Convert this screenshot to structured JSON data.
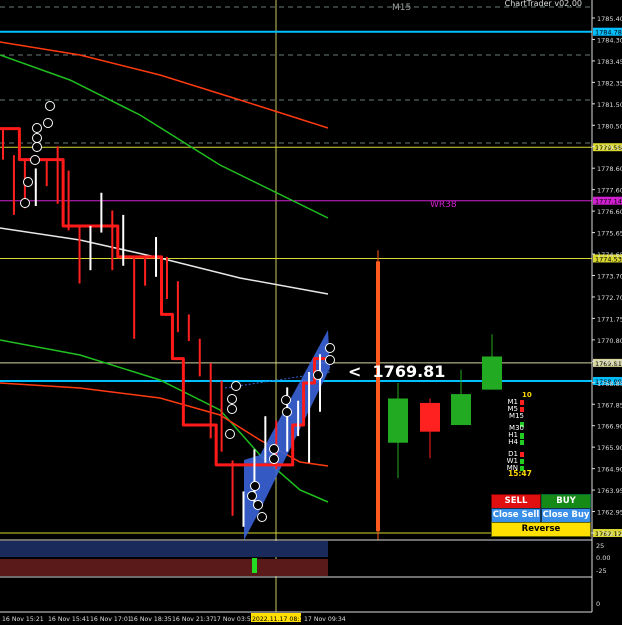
{
  "window": {
    "title": "ChartTrader v02.00",
    "timeframe": "M15"
  },
  "price_display": {
    "arrow": "<",
    "value": "1769.81"
  },
  "trade_buttons": {
    "sell": "SELL",
    "buy": "BUY",
    "close_sell": "Close Sell",
    "close_buy": "Close Buy",
    "reverse": "Reverse"
  },
  "timeframe_panel": {
    "count": "10",
    "items": [
      {
        "label": "M1",
        "color": "#ff2020"
      },
      {
        "label": "M5",
        "color": "#ff2020"
      },
      {
        "label": "M15",
        "color": "#22cc22"
      },
      {
        "label": "M30",
        "color": "#22cc22"
      },
      {
        "label": "H1",
        "color": "#22cc22"
      },
      {
        "label": "H4",
        "color": "#22cc22"
      },
      {
        "label": "D1",
        "color": "#ff2020"
      },
      {
        "label": "W1",
        "color": "#22cc22"
      },
      {
        "label": "MN",
        "color": "#22cc22"
      }
    ],
    "countdown": "15:47"
  },
  "level_labels": {
    "wr38": "WR38"
  },
  "chart_data": {
    "type": "candlestick",
    "symbol_timeframe": "M15",
    "price_axis": {
      "range": [
        1761.9,
        1785.9
      ],
      "ticks": [
        "1785.40",
        "1784.30",
        "1783.45",
        "1782.35",
        "1781.50",
        "1780.50",
        "1779.55",
        "1778.60",
        "1777.60",
        "1776.60",
        "1775.65",
        "1774.65",
        "1773.70",
        "1772.70",
        "1771.75",
        "1770.80",
        "1769.81",
        "1768.85",
        "1767.85",
        "1766.90",
        "1765.90",
        "1764.90",
        "1763.95",
        "1762.95",
        "1762.12"
      ]
    },
    "time_axis": {
      "labels": [
        "16 Nov 15:21",
        "16 Nov 15:41",
        "16 Nov 17:01",
        "16 Nov 18:35",
        "16 Nov 21:37",
        "17 Nov 03:52",
        "2022.11.17 08:17",
        "17 Nov 09:34"
      ]
    },
    "horizontal_lines": [
      {
        "price": 1784.78,
        "label": "1784.78",
        "color": "#00bfff"
      },
      {
        "price": 1779.56,
        "label": "1779.56",
        "color": "#d8d830"
      },
      {
        "price": 1777.14,
        "label": "1777.14",
        "color": "#d020d0"
      },
      {
        "price": 1774.53,
        "label": "1774.53",
        "color": "#d8d830"
      },
      {
        "price": 1769.81,
        "label": "1769.81",
        "color": "#d8d8a0"
      },
      {
        "price": 1768.99,
        "label": "1768.99",
        "color": "#00bfff"
      },
      {
        "price": 1762.12,
        "label": "1762.12",
        "color": "#d8d830"
      }
    ],
    "candles": [
      {
        "o": 1780.4,
        "h": 1780.4,
        "l": 1779.0,
        "c": 1779.0,
        "bull": false
      },
      {
        "o": 1779.0,
        "h": 1779.2,
        "l": 1776.5,
        "c": 1778.8,
        "bull": false
      },
      {
        "o": 1778.5,
        "h": 1779.0,
        "l": 1776.8,
        "c": 1777.2,
        "bull": false
      },
      {
        "o": 1777.2,
        "h": 1778.6,
        "l": 1776.9,
        "c": 1778.2,
        "bull": true
      },
      {
        "o": 1778.5,
        "h": 1779.0,
        "l": 1777.8,
        "c": 1778.8,
        "bull": false
      },
      {
        "o": 1779.0,
        "h": 1779.6,
        "l": 1777.0,
        "c": 1777.5,
        "bull": false
      },
      {
        "o": 1777.5,
        "h": 1778.5,
        "l": 1775.8,
        "c": 1776.0,
        "bull": false
      },
      {
        "o": 1775.8,
        "h": 1776.0,
        "l": 1773.4,
        "c": 1774.2,
        "bull": false
      },
      {
        "o": 1774.0,
        "h": 1776.0,
        "l": 1774.0,
        "c": 1775.5,
        "bull": true
      },
      {
        "o": 1776.5,
        "h": 1777.5,
        "l": 1775.7,
        "c": 1777.1,
        "bull": true
      },
      {
        "o": 1776.2,
        "h": 1776.7,
        "l": 1774.0,
        "c": 1774.4,
        "bull": false
      },
      {
        "o": 1774.5,
        "h": 1776.5,
        "l": 1774.2,
        "c": 1776.0,
        "bull": true
      },
      {
        "o": 1774.3,
        "h": 1774.6,
        "l": 1770.9,
        "c": 1771.5,
        "bull": false
      },
      {
        "o": 1774.6,
        "h": 1774.6,
        "l": 1773.3,
        "c": 1773.8,
        "bull": false
      },
      {
        "o": 1774.0,
        "h": 1775.5,
        "l": 1773.7,
        "c": 1775.3,
        "bull": true
      },
      {
        "o": 1774.4,
        "h": 1774.6,
        "l": 1772.7,
        "c": 1773.5,
        "bull": false
      },
      {
        "o": 1773.0,
        "h": 1773.5,
        "l": 1771.2,
        "c": 1771.6,
        "bull": false
      },
      {
        "o": 1771.7,
        "h": 1772.0,
        "l": 1770.8,
        "c": 1771.0,
        "bull": false
      },
      {
        "o": 1770.4,
        "h": 1770.9,
        "l": 1769.2,
        "c": 1769.6,
        "bull": false
      },
      {
        "o": 1769.4,
        "h": 1769.8,
        "l": 1766.4,
        "c": 1766.9,
        "bull": false
      },
      {
        "o": 1767.5,
        "h": 1769.0,
        "l": 1765.8,
        "c": 1766.2,
        "bull": false
      },
      {
        "o": 1765.2,
        "h": 1765.4,
        "l": 1762.9,
        "c": 1763.3,
        "bull": false
      },
      {
        "o": 1763.2,
        "h": 1764.0,
        "l": 1762.4,
        "c": 1763.7,
        "bull": true
      },
      {
        "o": 1763.7,
        "h": 1765.9,
        "l": 1763.3,
        "c": 1765.6,
        "bull": true
      },
      {
        "o": 1765.8,
        "h": 1767.4,
        "l": 1765.3,
        "c": 1767.0,
        "bull": true
      },
      {
        "o": 1766.8,
        "h": 1767.2,
        "l": 1765.0,
        "c": 1765.6,
        "bull": false
      },
      {
        "o": 1765.8,
        "h": 1768.7,
        "l": 1765.8,
        "c": 1767.7,
        "bull": true
      },
      {
        "o": 1767.0,
        "h": 1768.1,
        "l": 1766.5,
        "c": 1767.8,
        "bull": true
      },
      {
        "o": 1767.0,
        "h": 1769.4,
        "l": 1765.3,
        "c": 1769.1,
        "bull": true
      },
      {
        "o": 1768.3,
        "h": 1770.2,
        "l": 1767.6,
        "c": 1769.9,
        "bull": true
      }
    ],
    "step_line": [
      1780.4,
      1780.4,
      1779.0,
      1779.0,
      1779.0,
      1779.0,
      1776.0,
      1776.0,
      1776.0,
      1776.0,
      1776.0,
      1774.6,
      1774.6,
      1774.6,
      1774.6,
      1772.0,
      1770.0,
      1767.0,
      1767.0,
      1767.0,
      1765.2,
      1765.2,
      1765.2,
      1765.2,
      1765.2,
      1765.2,
      1765.2,
      1767.0,
      1768.9,
      1770.0
    ],
    "htf_candles": [
      {
        "o": 1762.2,
        "h": 1774.9,
        "l": 1762.2,
        "c": 1774.4,
        "color": "#ff5a1f"
      },
      {
        "o": 1768.2,
        "h": 1768.9,
        "l": 1764.6,
        "c": 1766.2,
        "color": "#22aa22"
      },
      {
        "o": 1768.0,
        "h": 1768.2,
        "l": 1765.5,
        "c": 1766.7,
        "color": "#ff2020"
      },
      {
        "o": 1767.0,
        "h": 1769.5,
        "l": 1767.0,
        "c": 1768.4,
        "color": "#22aa22"
      },
      {
        "o": 1768.6,
        "h": 1771.1,
        "l": 1768.6,
        "c": 1770.1,
        "color": "#22aa22"
      }
    ],
    "osc_axis": {
      "ticks": [
        "25",
        "0.00",
        "-25",
        "0"
      ]
    }
  }
}
